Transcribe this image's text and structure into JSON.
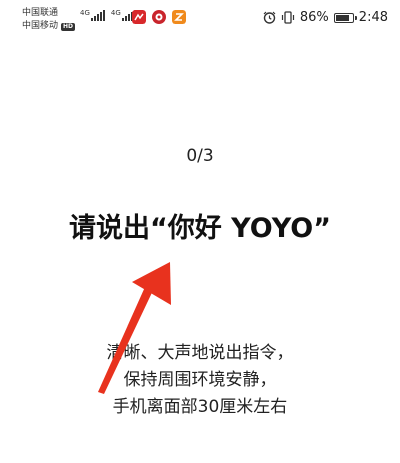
{
  "status_bar": {
    "carrier_1": "中国联通",
    "carrier_2": "中国移动",
    "hd_badge": "HD",
    "signal_1_type": "4G",
    "signal_2_type": "4G",
    "battery_percent": "86%",
    "battery_level": 0.86,
    "time": "2:48"
  },
  "voice_enroll": {
    "progress": "0/3",
    "prompt": "请说出“你好 YOYO”",
    "instructions": [
      "清晰、大声地说出指令，",
      "保持周围环境安静，",
      "手机离面部30厘米左右"
    ]
  },
  "annotation": {
    "arrow_color": "#e8321e"
  }
}
